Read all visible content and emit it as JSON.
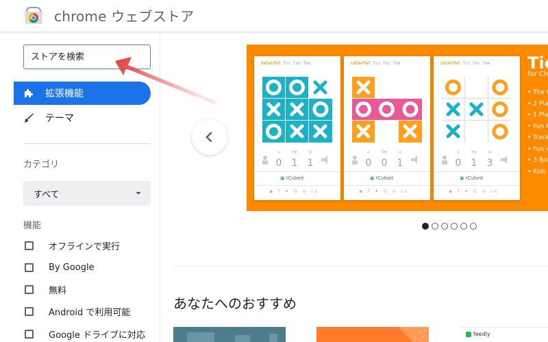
{
  "header": {
    "brand": "chrome ウェブストア"
  },
  "search": {
    "placeholder": "ストアを検索"
  },
  "nav": {
    "extensions": "拡張機能",
    "themes": "テーマ"
  },
  "category": {
    "label": "カテゴリ",
    "selected": "すべて"
  },
  "features": {
    "label": "機能",
    "items": [
      "オフラインで実行",
      "By Google",
      "無料",
      "Android で利用可能",
      "Google ドライブに対応"
    ]
  },
  "carousel": {
    "card_title_a": "Colorful",
    "card_title_b": " Tic Tac Toe",
    "scores": [
      {
        "x": "0",
        "tie": "1",
        "o": "1"
      },
      {
        "x": "0",
        "tie": "0",
        "o": "1"
      },
      {
        "x": "0",
        "tie": "1",
        "o": "3"
      }
    ],
    "score_heads": {
      "x": "X",
      "tie": "TIE",
      "o": "O"
    },
    "brand_mark": "tCubed",
    "promo_title": "Tic",
    "promo_subtitle": "for Ch",
    "promo_points": [
      "• The C",
      "• 2 Play",
      "• 1 Play",
      "• Fun M",
      "• Track",
      "• Fun a",
      "• 3 Boa",
      "• Kids L"
    ],
    "active_slide": 1,
    "slide_count": 6
  },
  "recommended": {
    "title": "あなたへのおすすめ"
  },
  "tiles": {
    "third_label": "feedly"
  },
  "colors": {
    "accent": "#1a73e8",
    "promo_bg": "#ff8a00",
    "x_mark": "#1ab3c6",
    "o_mark": "#ff9f1c",
    "pink": "#ec5896",
    "annotation_arrow": "#e53935"
  }
}
